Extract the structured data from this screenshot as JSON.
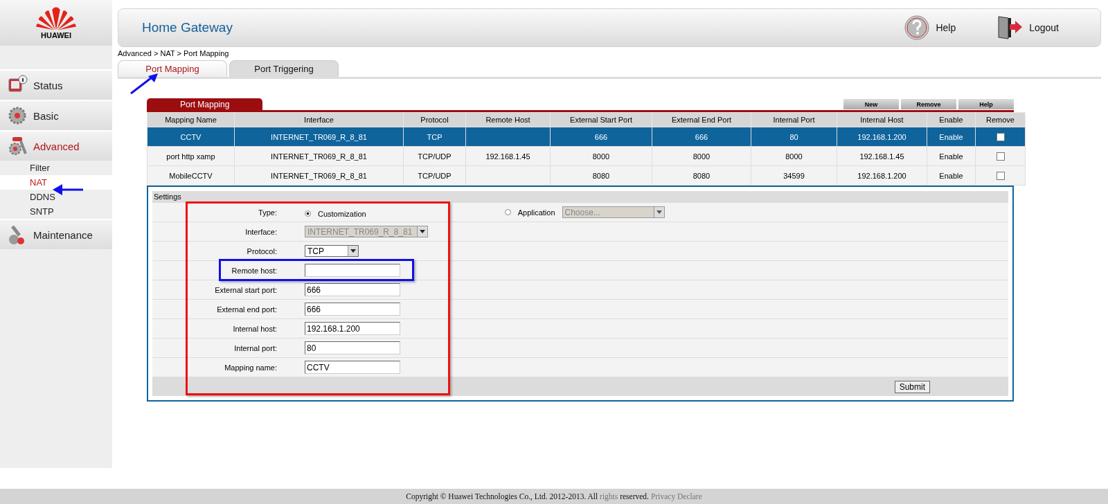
{
  "brand": {
    "name": "HUAWEI"
  },
  "header": {
    "title": "Home Gateway",
    "help": "Help",
    "logout": "Logout"
  },
  "breadcrumb": "Advanced > NAT > Port Mapping",
  "sidebar": {
    "items": [
      {
        "label": "Status",
        "selected": false
      },
      {
        "label": "Basic",
        "selected": false
      },
      {
        "label": "Advanced",
        "selected": true,
        "children": [
          {
            "label": "Filter",
            "selected": false
          },
          {
            "label": "NAT",
            "selected": true
          },
          {
            "label": "DDNS",
            "selected": false
          },
          {
            "label": "SNTP",
            "selected": false
          }
        ]
      },
      {
        "label": "Maintenance",
        "selected": false
      }
    ]
  },
  "tabs": [
    {
      "label": "Port Mapping",
      "selected": true
    },
    {
      "label": "Port Triggering",
      "selected": false
    }
  ],
  "table": {
    "title": "Port Mapping",
    "actions": [
      "New",
      "Remove",
      "Help"
    ],
    "columns": [
      "Mapping Name",
      "Interface",
      "Protocol",
      "Remote Host",
      "External Start Port",
      "External End Port",
      "Internal Port",
      "Internal Host",
      "Enable",
      "Remove"
    ],
    "rows": [
      {
        "selected": true,
        "cells": [
          "CCTV",
          "INTERNET_TR069_R_8_81",
          "TCP",
          "",
          "666",
          "666",
          "80",
          "192.168.1.200",
          "Enable"
        ],
        "remove_checked": false
      },
      {
        "selected": false,
        "cells": [
          "port http xamp",
          "INTERNET_TR069_R_8_81",
          "TCP/UDP",
          "192.168.1.45",
          "8000",
          "8000",
          "8000",
          "192.168.1.45",
          "Enable"
        ],
        "remove_checked": false
      },
      {
        "selected": false,
        "cells": [
          "MobileCCTV",
          "INTERNET_TR069_R_8_81",
          "TCP/UDP",
          "",
          "8080",
          "8080",
          "34599",
          "192.168.1.200",
          "Enable"
        ],
        "remove_checked": false
      }
    ]
  },
  "settings": {
    "title": "Settings",
    "type": {
      "label": "Type:",
      "options": [
        {
          "label": "Customization",
          "selected": true
        },
        {
          "label": "Application",
          "selected": false
        }
      ],
      "application_select": {
        "placeholder": "Choose...",
        "disabled": true
      }
    },
    "fields": [
      {
        "label": "Interface:",
        "kind": "select",
        "value": "INTERNET_TR069_R_8_81",
        "disabled": true
      },
      {
        "label": "Protocol:",
        "kind": "select",
        "value": "TCP",
        "disabled": false
      },
      {
        "label": "Remote host:",
        "kind": "text"
      },
      {
        "label": "External start port:",
        "kind": "text",
        "value": "666"
      },
      {
        "label": "External end port:",
        "kind": "text",
        "value": "666"
      },
      {
        "label": "Internal host:",
        "kind": "text",
        "value": "192.168.1.200"
      },
      {
        "label": "Internal port:",
        "kind": "text",
        "value": "80"
      },
      {
        "label": "Mapping name:",
        "kind": "text",
        "value": "CCTV"
      }
    ],
    "submit": "Submit"
  },
  "annotations": [
    {
      "kind": "arrow",
      "color": "#1010ee"
    },
    {
      "kind": "arrow",
      "color": "#1010ee"
    },
    {
      "kind": "box",
      "color": "#ee1111"
    },
    {
      "kind": "box",
      "color": "#1010ee"
    }
  ],
  "footer": {
    "parts": [
      {
        "text": "Copyright © Huawei Technologies Co., Ltd. 2012-2013. All",
        "muted": false
      },
      {
        "text": "rights",
        "muted": true
      },
      {
        "text": "reserved.",
        "muted": false
      }
    ],
    "link": "Privacy Declare"
  }
}
